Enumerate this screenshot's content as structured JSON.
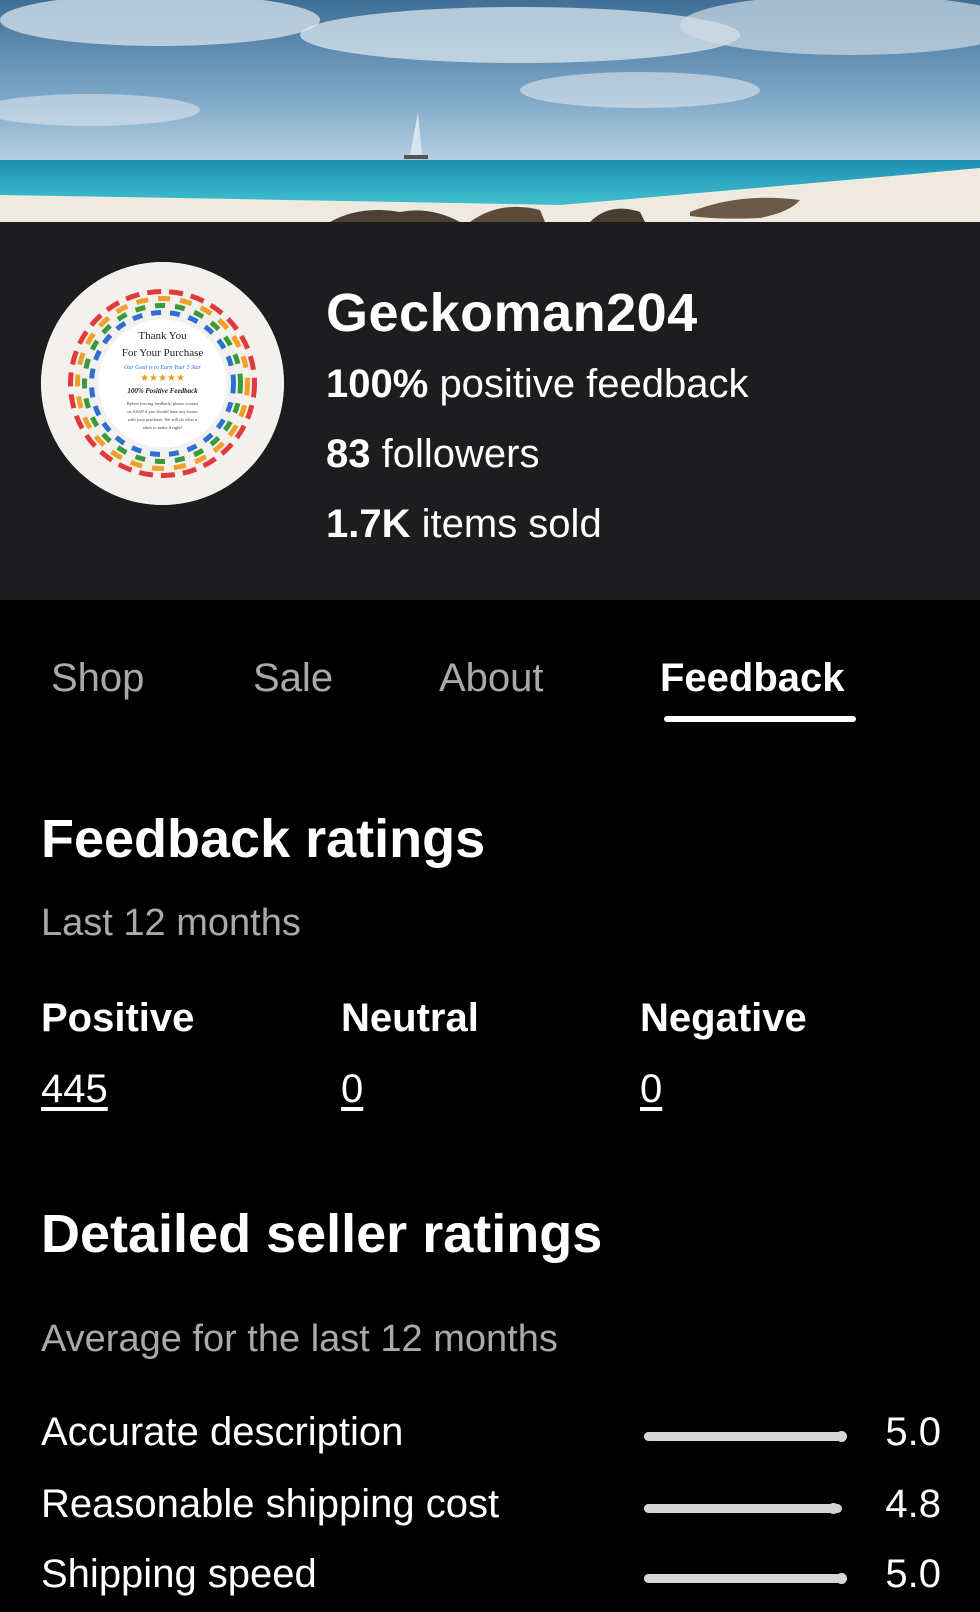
{
  "banner": {
    "icon": "beach-banner-image"
  },
  "seller": {
    "avatar_icon": "thank-you-sticker-avatar",
    "avatar_text": {
      "line1": "Thank You",
      "line2": "For Your Purchase",
      "line3": "Our Goal is to Earn Your 5 Star",
      "stars": "★★★★★",
      "line4": "100% Positive Feedback",
      "line5": "Before leaving feedback, please contact",
      "line6": "us ASAP if you should have any issues",
      "line7": "with your purchase. We will do what it",
      "line8": "takes to make it right!"
    },
    "name": "Geckoman204",
    "feedback_value": "100%",
    "feedback_label": "positive feedback",
    "followers_value": "83",
    "followers_label": "followers",
    "sold_value": "1.7K",
    "sold_label": "items sold"
  },
  "tabs": [
    {
      "label": "Shop",
      "active": false
    },
    {
      "label": "Sale",
      "active": false
    },
    {
      "label": "About",
      "active": false
    },
    {
      "label": "Feedback",
      "active": true
    }
  ],
  "feedback_ratings": {
    "title": "Feedback ratings",
    "period": "Last 12 months",
    "positive": {
      "label": "Positive",
      "value": "445"
    },
    "neutral": {
      "label": "Neutral",
      "value": "0"
    },
    "negative": {
      "label": "Negative",
      "value": "0"
    }
  },
  "detailed_ratings": {
    "title": "Detailed seller ratings",
    "period": "Average for the last 12 months",
    "items": [
      {
        "label": "Accurate description",
        "value": "5.0",
        "fraction": 1.0
      },
      {
        "label": "Reasonable shipping cost",
        "value": "4.8",
        "fraction": 0.96
      },
      {
        "label": "Shipping speed",
        "value": "5.0",
        "fraction": 1.0
      }
    ]
  },
  "colors": {
    "header_bg": "#1d1d1f",
    "page_bg": "#000000",
    "text_primary": "#ffffff",
    "text_secondary": "#a9a9a9",
    "bar": "#d6d6d6"
  }
}
